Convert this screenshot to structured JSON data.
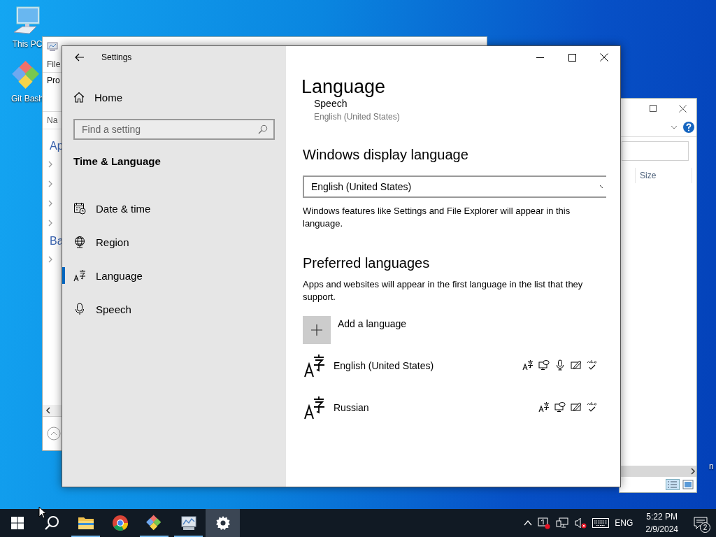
{
  "desktop": {
    "icons": [
      {
        "label": "This PC",
        "kind": "computer"
      },
      {
        "label": "Git Bash",
        "kind": "git"
      }
    ],
    "edge_label": "n"
  },
  "explorer_back": {
    "menu": "File",
    "ribbon_tab": "Pro",
    "column_header": "Na",
    "items": [
      {
        "kind": "group",
        "label": "Ap"
      },
      {
        "kind": "row"
      },
      {
        "kind": "row"
      },
      {
        "kind": "row"
      },
      {
        "kind": "row"
      },
      {
        "kind": "group",
        "label": "Ba"
      },
      {
        "kind": "row"
      }
    ]
  },
  "explorer_right": {
    "column_header": "Size"
  },
  "settings": {
    "title": "Settings",
    "home": "Home",
    "search": {
      "placeholder": "Find a setting"
    },
    "section": "Time & Language",
    "nav": [
      {
        "label": "Date & time",
        "kind": "calendar",
        "selected": false
      },
      {
        "label": "Region",
        "kind": "globe",
        "selected": false
      },
      {
        "label": "Language",
        "kind": "language",
        "selected": true
      },
      {
        "label": "Speech",
        "kind": "microphone",
        "selected": false
      }
    ],
    "page": {
      "title": "Language",
      "speech": {
        "label": "Speech",
        "value": "English (United States)"
      },
      "display_language": {
        "heading": "Windows display language",
        "value": "English (United States)",
        "note": "Windows features like Settings and File Explorer will appear in this language."
      },
      "preferred": {
        "heading": "Preferred languages",
        "note": "Apps and websites will appear in the first language in the list that they support.",
        "add_label": "Add a language",
        "languages": [
          {
            "name": "English (United States)",
            "features": [
              {
                "kind": "display-language"
              },
              {
                "kind": "text-to-speech"
              },
              {
                "kind": "speech"
              },
              {
                "kind": "handwriting"
              },
              {
                "kind": "spelling"
              }
            ]
          },
          {
            "name": "Russian",
            "features": [
              {
                "kind": "display-language"
              },
              {
                "kind": "text-to-speech"
              },
              {
                "kind": "handwriting"
              },
              {
                "kind": "spelling"
              }
            ]
          }
        ]
      }
    }
  },
  "taskbar": {
    "apps": [
      {
        "kind": "file-explorer",
        "open": true,
        "selected": false
      },
      {
        "kind": "chrome",
        "open": false,
        "selected": false
      },
      {
        "kind": "git",
        "open": true,
        "selected": false
      },
      {
        "kind": "monitor-app",
        "open": true,
        "selected": false
      },
      {
        "kind": "settings",
        "open": false,
        "selected": true
      }
    ],
    "tray": {
      "language": "ENG",
      "time": "5:22 PM",
      "date": "2/9/2024",
      "notifications": "2"
    }
  }
}
